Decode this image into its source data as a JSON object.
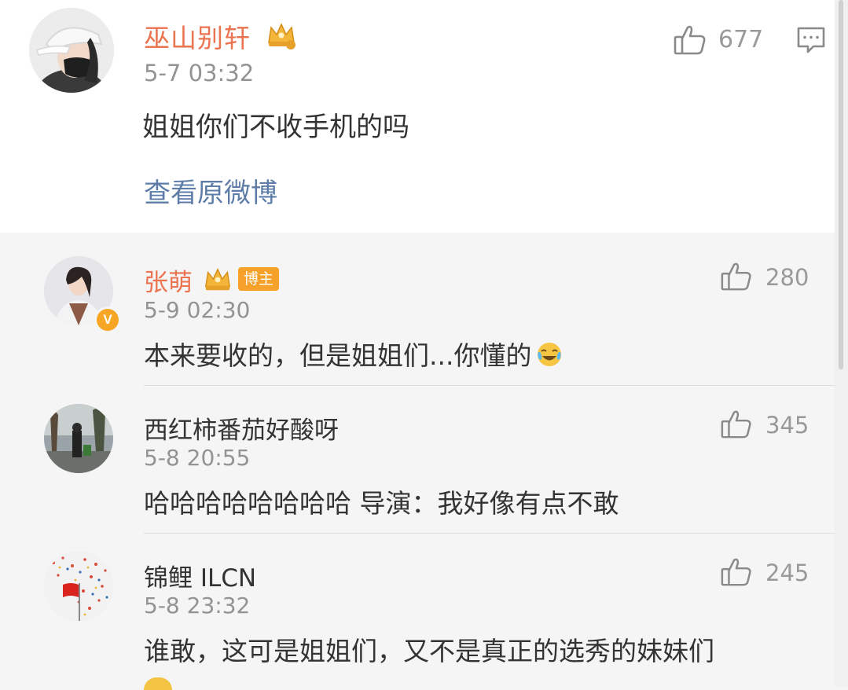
{
  "root_comment": {
    "username": "巫山别轩",
    "time": "5-7 03:32",
    "text": "姐姐你们不收手机的吗",
    "view_original": "查看原微博",
    "likes": "677"
  },
  "replies": [
    {
      "username": "张萌",
      "host_tag": "博主",
      "time": "5-9 02:30",
      "text": "本来要收的，但是姐姐们...你懂的",
      "likes": "280",
      "verified_badge": "V"
    },
    {
      "username": "西红柿番茄好酸呀",
      "time": "5-8 20:55",
      "text": "哈哈哈哈哈哈哈哈 导演：我好像有点不敢",
      "likes": "345"
    },
    {
      "username": "锦鲤 ILCN",
      "time": "5-8 23:32",
      "text": "谁敢，这可是姐姐们，又不是真正的选秀的妹妹们",
      "likes": "245"
    }
  ],
  "icons": {
    "like": "thumbs-up-icon",
    "reply": "comment-icon",
    "vip": "crown-icon",
    "emoji": "laughing-tears-emoji"
  },
  "colors": {
    "vip_name": "#eb7350",
    "link": "#5d7da8",
    "host_tag": "#f6a12a",
    "muted": "#939393",
    "text": "#333333"
  }
}
